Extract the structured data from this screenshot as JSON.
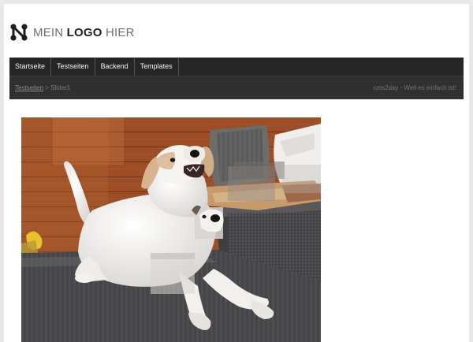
{
  "logo": {
    "text_light": "MEIN ",
    "text_bold": "LOGO",
    "text_tail": " HIER",
    "icon": "molecule-n-icon"
  },
  "nav": {
    "items": [
      {
        "label": "Startseite"
      },
      {
        "label": "Testseiten"
      },
      {
        "label": "Backend"
      },
      {
        "label": "Templates"
      }
    ]
  },
  "breadcrumb": {
    "link": "Testseiten",
    "separator": " > ",
    "current": "Slider1"
  },
  "tagline": "cms2day - Weil es einfach ist!",
  "slider": {
    "image": "dog-on-couch-photo"
  },
  "colors": {
    "nav_bg": "#262626",
    "subbar_bg": "#303030",
    "page_bg": "#ffffff",
    "frame_bg": "#e9e9e9"
  }
}
